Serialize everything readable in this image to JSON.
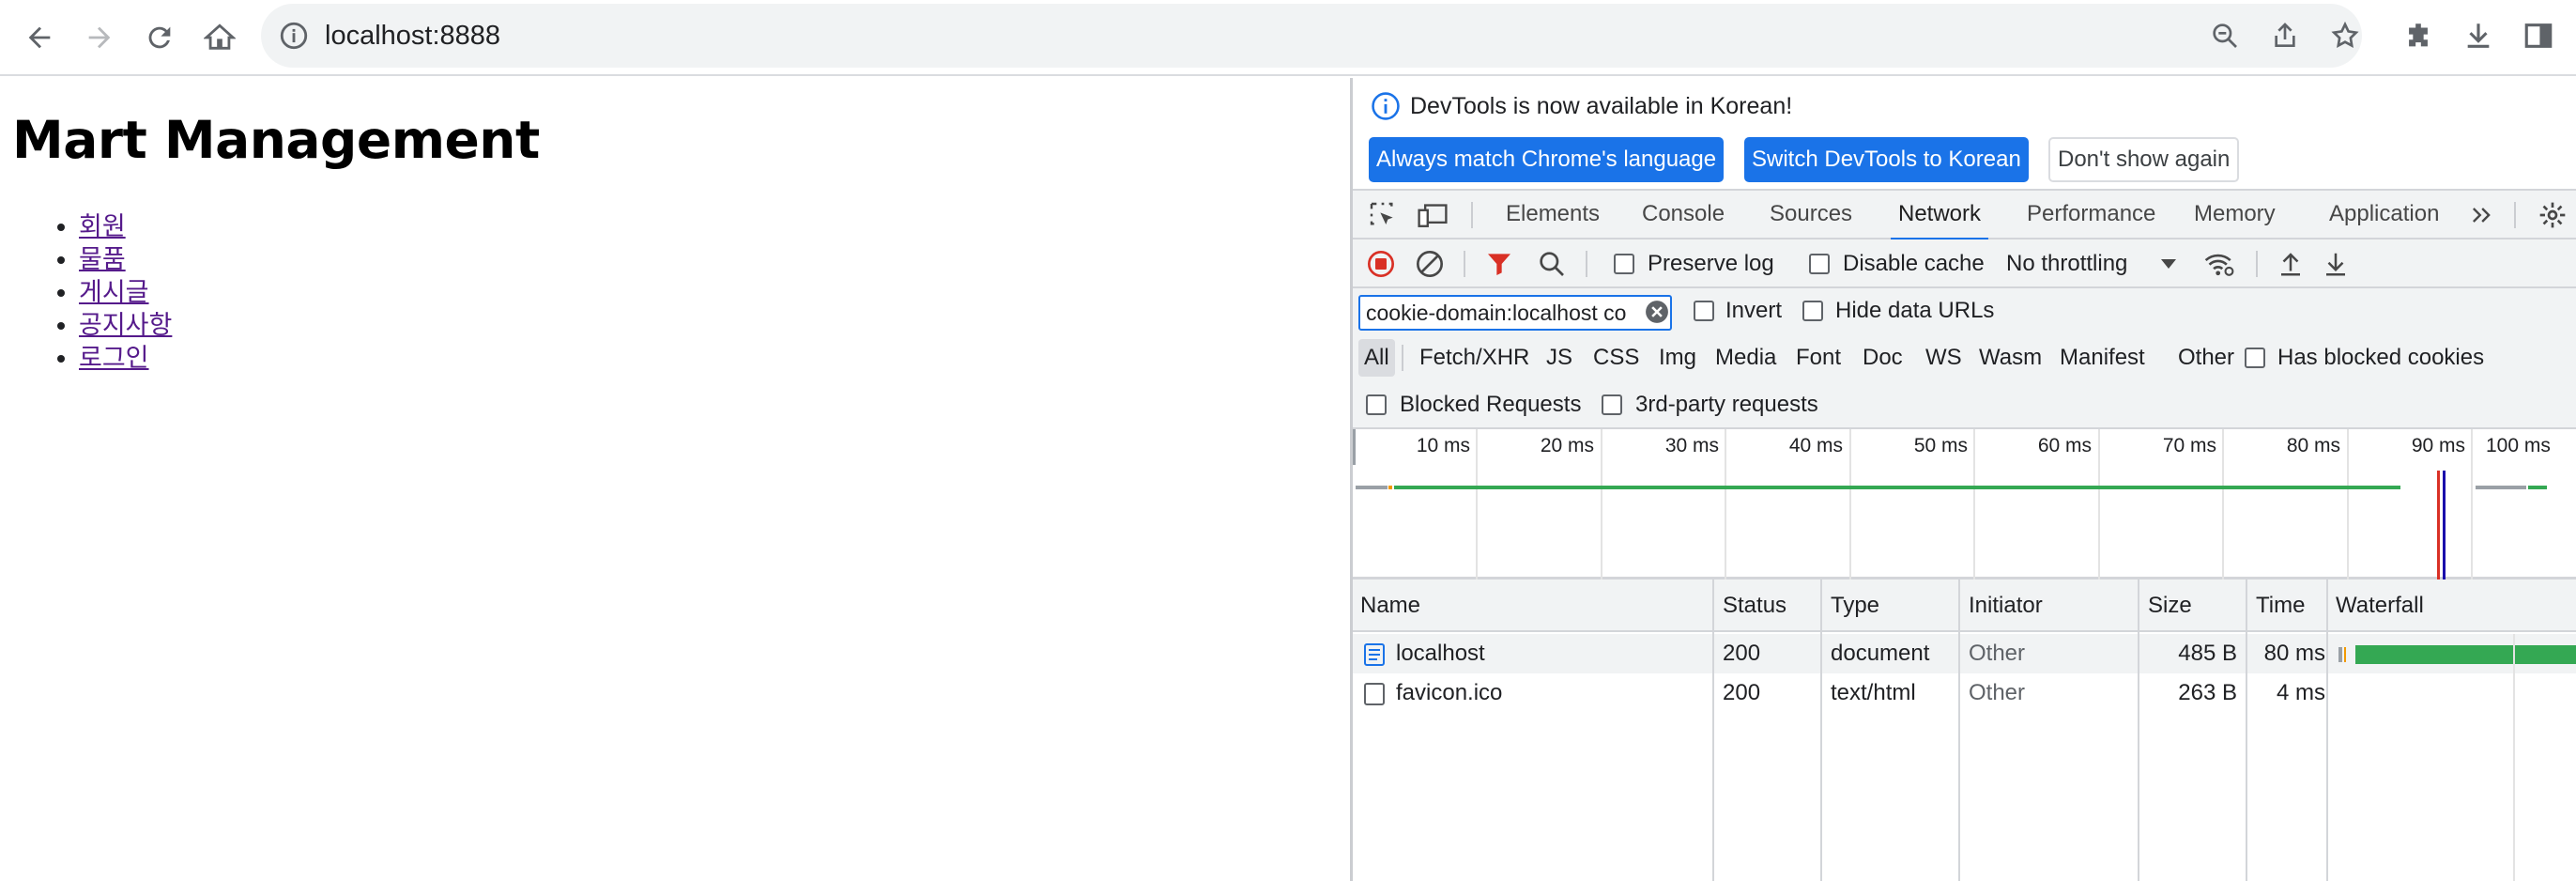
{
  "browser": {
    "url": "localhost:8888",
    "icons": [
      "back-icon",
      "forward-icon",
      "reload-icon",
      "home-icon",
      "info-icon",
      "zoom-out-icon",
      "share-icon",
      "bookmark-star-icon",
      "extensions-icon",
      "download-icon",
      "side-panel-icon"
    ]
  },
  "page": {
    "title": "Mart Management",
    "links": [
      "회원",
      "물품",
      "게시글",
      "공지사항",
      "로그인"
    ]
  },
  "devtools": {
    "infobar": {
      "message": "DevTools is now available in Korean!",
      "btn_match": "Always match Chrome's language",
      "btn_switch": "Switch DevTools to Korean",
      "btn_dismiss": "Don't show again"
    },
    "tabs": [
      "Elements",
      "Console",
      "Sources",
      "Network",
      "Performance",
      "Memory",
      "Application"
    ],
    "active_tab": "Network",
    "network_toolbar": {
      "preserve_log": "Preserve log",
      "disable_cache": "Disable cache",
      "throttling": "No throttling"
    },
    "filter": {
      "value": "cookie-domain:localhost co",
      "invert": "Invert",
      "hide_data_urls": "Hide data URLs"
    },
    "types": [
      "All",
      "Fetch/XHR",
      "JS",
      "CSS",
      "Img",
      "Media",
      "Font",
      "Doc",
      "WS",
      "Wasm",
      "Manifest",
      "Other"
    ],
    "has_blocked_cookies": "Has blocked cookies",
    "blocked_requests": "Blocked Requests",
    "third_party": "3rd-party requests",
    "timeline_ticks": [
      "10 ms",
      "20 ms",
      "30 ms",
      "40 ms",
      "50 ms",
      "60 ms",
      "70 ms",
      "80 ms",
      "90 ms",
      "100 ms"
    ],
    "columns": [
      "Name",
      "Status",
      "Type",
      "Initiator",
      "Size",
      "Time",
      "Waterfall"
    ],
    "rows": [
      {
        "name": "localhost",
        "status": "200",
        "type": "document",
        "initiator": "Other",
        "size": "485 B",
        "time": "80 ms"
      },
      {
        "name": "favicon.ico",
        "status": "200",
        "type": "text/html",
        "initiator": "Other",
        "size": "263 B",
        "time": "4 ms"
      }
    ],
    "colors": {
      "accent": "#1a73e8",
      "waterfall_green": "#34a853",
      "record_red": "#d93025"
    }
  }
}
